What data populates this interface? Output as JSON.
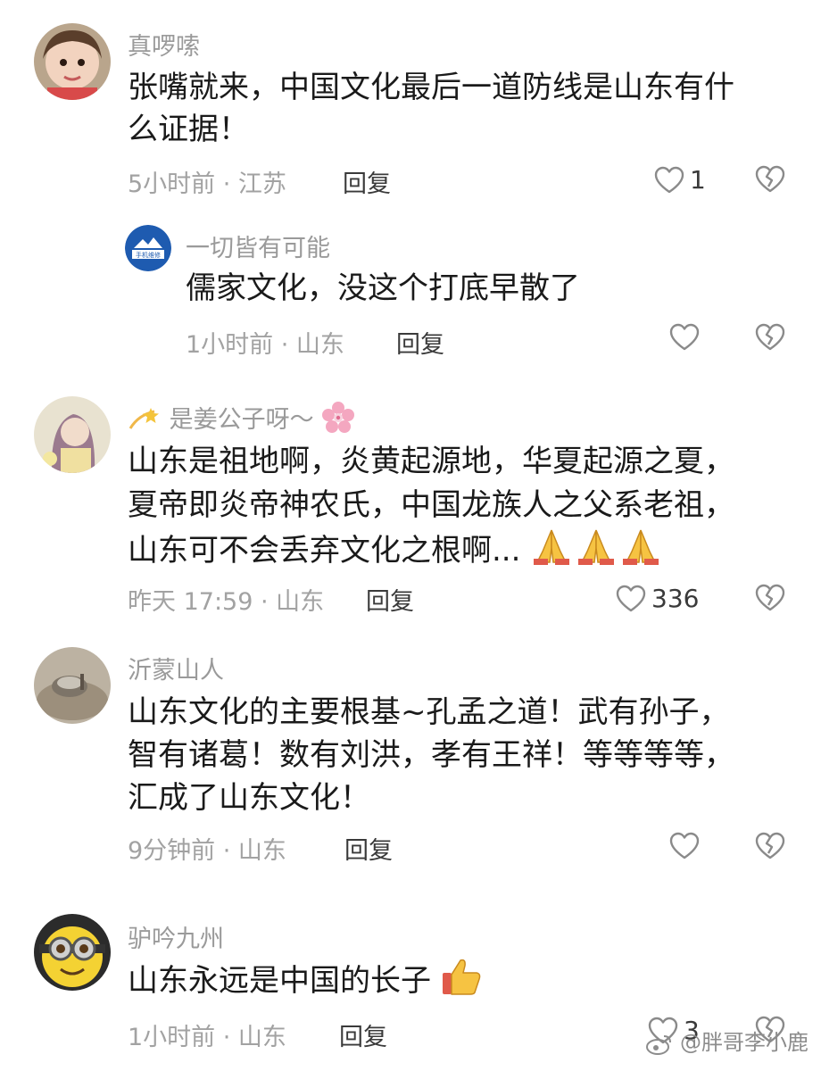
{
  "comments": [
    {
      "username": "真啰嗦",
      "lines": [
        "张嘴就来，中国文化最后一道防线是山东有什",
        "么证据！"
      ],
      "time_location": "5小时前 · 江苏",
      "reply_label": "回复",
      "like_count": "1"
    },
    {
      "username": "一切皆有可能",
      "avatar_text": "手机维修",
      "lines": [
        "儒家文化，没这个打底早散了"
      ],
      "time_location": "1小时前 · 山东",
      "reply_label": "回复",
      "like_count": ""
    },
    {
      "username": "是姜公子呀～",
      "lines": [
        "山东是祖地啊，炎黄起源地，华夏起源之夏，",
        "夏帝即炎帝神农氏，中国龙族人之父系老祖，",
        "山东可不会丢弃文化之根啊..."
      ],
      "time_location": "昨天 17:59 · 山东",
      "reply_label": "回复",
      "like_count": "336"
    },
    {
      "username": "沂蒙山人",
      "lines": [
        "山东文化的主要根基~孔孟之道！武有孙子，",
        "智有诸葛！数有刘洪，孝有王祥！等等等等，",
        "汇成了山东文化！"
      ],
      "time_location": "9分钟前 · 山东",
      "reply_label": "回复",
      "like_count": ""
    },
    {
      "username": "驴吟九州",
      "lines": [
        "山东永远是中国的长子"
      ],
      "time_location": "1小时前 · 山东",
      "reply_label": "回复",
      "like_count": "3"
    }
  ],
  "watermark": "@胖哥李小鹿",
  "icons": {
    "like": "heart-outline-icon",
    "dislike": "broken-heart-icon",
    "username_prefix": "dizzy-star-emoji",
    "username_suffix": "cherry-blossom-emoji",
    "text_suffix": "folded-hands-emoji",
    "thumbs": "thumbs-up-emoji"
  },
  "colors": {
    "meta_gray": "#a2a2a2",
    "text": "#1a1a1a",
    "icon_gray": "#8a8a8a"
  }
}
